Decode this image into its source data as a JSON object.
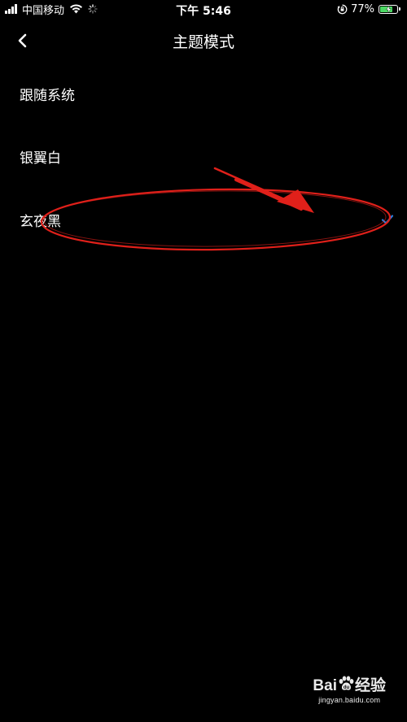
{
  "status_bar": {
    "carrier": "中国移动",
    "time": "下午 5:46",
    "battery_percent": "77%",
    "battery_level": 0.77,
    "icons": [
      "signal-icon",
      "wifi-icon",
      "activity-spinner-icon",
      "orientation-lock-icon",
      "battery-charging-icon"
    ]
  },
  "nav": {
    "title": "主题模式",
    "back_icon": "chevron-left-icon"
  },
  "theme_options": [
    {
      "label": "跟随系统",
      "selected": false
    },
    {
      "label": "银翼白",
      "selected": false
    },
    {
      "label": "玄夜黑",
      "selected": true
    }
  ],
  "colors": {
    "background": "#000000",
    "text": "#ffffff",
    "check": "#2f7fe0",
    "annotation": "#e0201a",
    "battery_fill": "#4cd964"
  },
  "watermark": {
    "logo": "Bai du 经验",
    "url": "jingyan.baidu.com"
  }
}
